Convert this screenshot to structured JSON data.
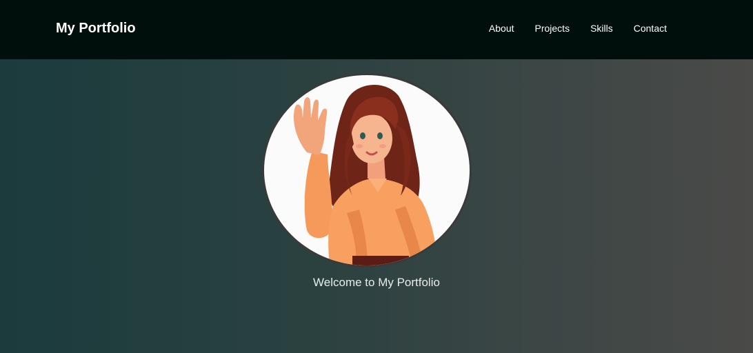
{
  "navbar": {
    "brand": "My Portfolio",
    "links": [
      {
        "label": "About"
      },
      {
        "label": "Projects"
      },
      {
        "label": "Skills"
      },
      {
        "label": "Contact"
      }
    ]
  },
  "hero": {
    "welcome_text": "Welcome to My Portfolio",
    "avatar": "waving-woman-illustration"
  },
  "colors": {
    "navbar_bg": "#000f0b",
    "gradient_start": "#1b3b3d",
    "gradient_end": "#4a4a48",
    "shirt": "#f49a5c",
    "hair": "#7a2a1c"
  }
}
